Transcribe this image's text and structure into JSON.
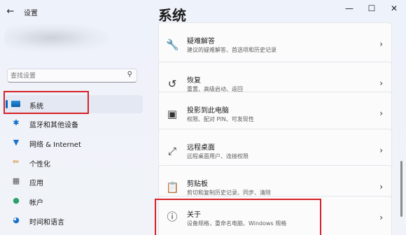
{
  "window": {
    "app_title": "设置",
    "back_glyph": "←",
    "min_glyph": "—",
    "max_glyph": "☐",
    "close_glyph": "✕"
  },
  "search": {
    "placeholder": "查找设置",
    "icon": "search-icon"
  },
  "sidebar": {
    "items": [
      {
        "label": "系统",
        "icon": "monitor-icon",
        "selected": true
      },
      {
        "label": "蓝牙和其他设备",
        "icon": "bluetooth-icon"
      },
      {
        "label": "网络 & Internet",
        "icon": "wifi-icon"
      },
      {
        "label": "个性化",
        "icon": "brush-icon"
      },
      {
        "label": "应用",
        "icon": "apps-icon"
      },
      {
        "label": "帐户",
        "icon": "person-icon"
      },
      {
        "label": "时间和语言",
        "icon": "globe-clock-icon"
      }
    ]
  },
  "main": {
    "page_title": "系统",
    "cards": [
      {
        "title": "疑难解答",
        "subtitle": "建议的疑难解答、首选项和历史记录",
        "icon": "wrench-icon"
      },
      {
        "title": "恢复",
        "subtitle": "重置、高级启动、返回",
        "icon": "recovery-icon"
      },
      {
        "title": "投影到此电脑",
        "subtitle": "权限、配对 PIN、可发现性",
        "icon": "project-icon"
      },
      {
        "title": "远程桌面",
        "subtitle": "远程桌面用户、连接权限",
        "icon": "remote-desktop-icon"
      },
      {
        "title": "剪贴板",
        "subtitle": "剪切和复制历史记录、同步、清除",
        "icon": "clipboard-icon"
      },
      {
        "title": "关于",
        "subtitle": "设备规格，重命名电脑、Windows 规格",
        "icon": "info-icon"
      }
    ]
  },
  "colors": {
    "accent": "#0067c0",
    "highlight_box": "#d52127"
  }
}
